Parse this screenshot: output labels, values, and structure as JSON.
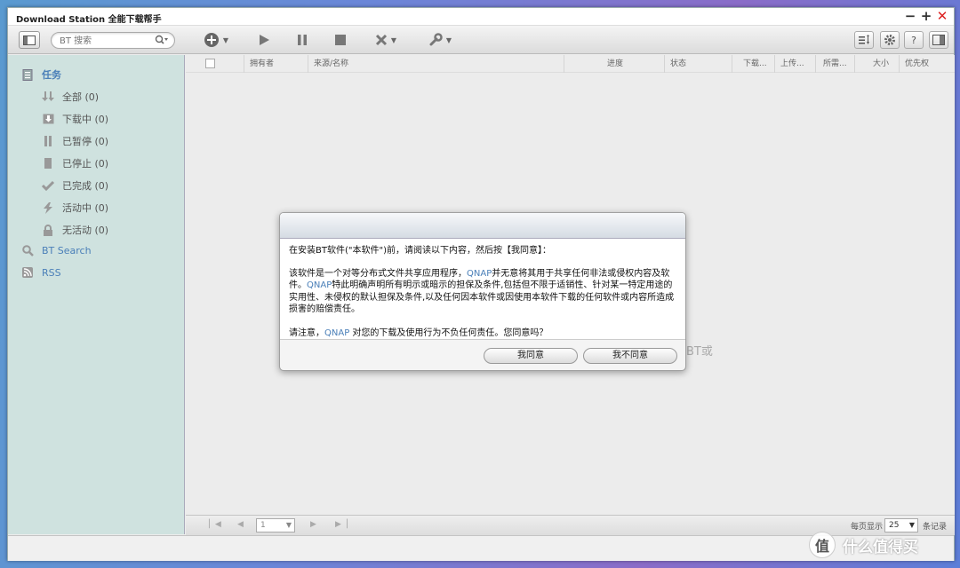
{
  "window": {
    "title": "Download Station 全能下载帮手",
    "controls": {
      "minimize": "−",
      "maximize": "+",
      "close": "✕"
    }
  },
  "toolbar": {
    "search_placeholder": "BT 搜索",
    "icons": [
      "sidebar-toggle-icon",
      "search-icon",
      "add-icon",
      "play-icon",
      "pause-icon",
      "stop-icon",
      "remove-icon",
      "wrench-icon",
      "sort-icon",
      "gear-icon",
      "help-icon",
      "panel-icon"
    ],
    "help_label": "?"
  },
  "sidebar": {
    "section": "任务",
    "items": [
      {
        "label": "全部 (0)",
        "icon": "download-arrows-icon"
      },
      {
        "label": "下载中 (0)",
        "icon": "downloading-icon"
      },
      {
        "label": "已暂停 (0)",
        "icon": "pause-icon"
      },
      {
        "label": "已停止 (0)",
        "icon": "stop-icon"
      },
      {
        "label": "已完成 (0)",
        "icon": "check-icon"
      },
      {
        "label": "活动中 (0)",
        "icon": "bolt-icon"
      },
      {
        "label": "无活动 (0)",
        "icon": "lock-icon"
      }
    ],
    "bt_search": "BT Search",
    "rss": "RSS"
  },
  "table": {
    "columns": [
      "拥有者",
      "来源/名称",
      "进度",
      "状态",
      "下载...",
      "上传...",
      "所需...",
      "大小",
      "优先权"
    ]
  },
  "background_text": "BT或",
  "pager": {
    "page": "1",
    "per_page_label": "每页显示",
    "per_page_value": "25",
    "records_label": "条记录"
  },
  "dialog": {
    "line1": "在安装BT软件(\"本软件\")前，请阅读以下内容，然后按【我同意】：",
    "p2a": "该软件是一个对等分布式文件共享应用程序，",
    "p2q": "QNAP",
    "p2b": "并无意将其用于共享任何非法或侵权内容及软件。",
    "p2q2": "QNAP",
    "p2c": "特此明确声明所有明示或暗示的担保及条件,包括但不限于适销性、针对某一特定用途的实用性、未侵权的默认担保及条件,以及任何因本软件或因使用本软件下载的任何软件或内容所造成损害的赔偿责任。",
    "p3a": "请注意，",
    "p3q": "QNAP",
    "p3b": " 对您的下载及使用行为不负任何责任。您同意吗？",
    "agree": "我同意",
    "disagree": "我不同意"
  },
  "brand": {
    "logo": "值",
    "text": "什么值得买"
  },
  "colors": {
    "accent": "#4a7fb8",
    "sidebar_bg": "#cfe2df",
    "close": "#dd2222"
  }
}
